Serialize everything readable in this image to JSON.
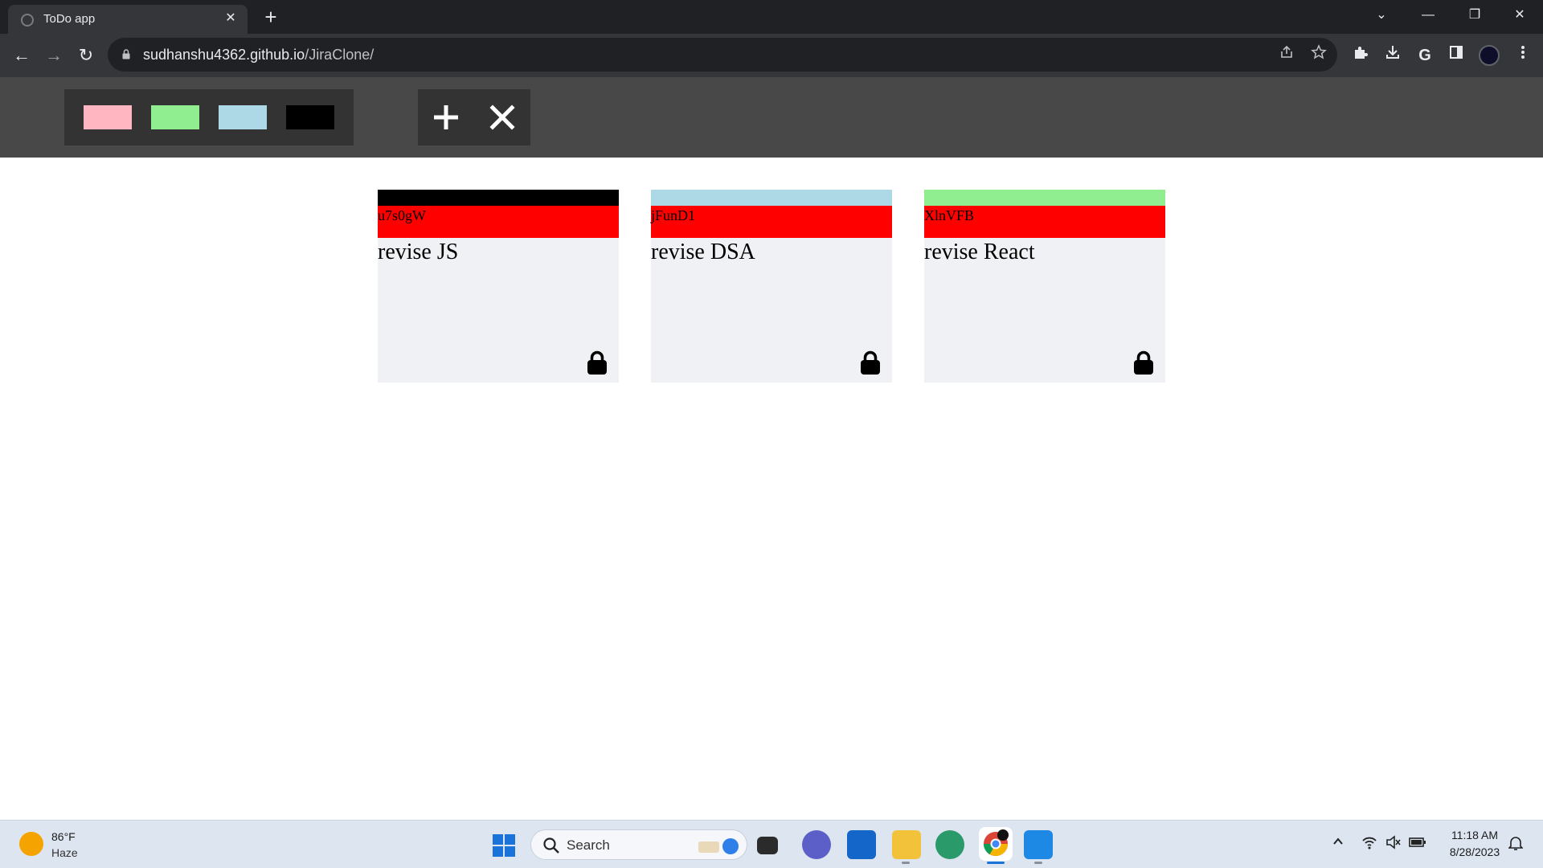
{
  "browser": {
    "tab_title": "ToDo app",
    "tab_close_glyph": "✕",
    "new_tab_glyph": "+",
    "url_host": "sudhanshu4362.github.io",
    "url_path": "/JiraClone/",
    "controls": {
      "tab_list": "⌄",
      "minimize": "—",
      "restore": "❐",
      "close": "✕"
    },
    "nav": {
      "back": "←",
      "forward": "→",
      "reload": "↻"
    },
    "extensions": {
      "google": "G"
    }
  },
  "app": {
    "palette": [
      {
        "name": "pink",
        "color": "#ffb6c1"
      },
      {
        "name": "lightgreen",
        "color": "#90ee90"
      },
      {
        "name": "lightblue",
        "color": "#add8e6"
      },
      {
        "name": "black",
        "color": "#000000"
      }
    ],
    "tickets": [
      {
        "id": "u7s0gW",
        "task": "revise JS",
        "color": "#000000"
      },
      {
        "id": "jFunD1",
        "task": "revise DSA",
        "color": "#add8e6"
      },
      {
        "id": "XlnVFB",
        "task": "revise React",
        "color": "#90ee90"
      }
    ]
  },
  "taskbar": {
    "weather_temp": "86°F",
    "weather_desc": "Haze",
    "search_label": "Search",
    "time": "11:18 AM",
    "date": "8/28/2023"
  }
}
